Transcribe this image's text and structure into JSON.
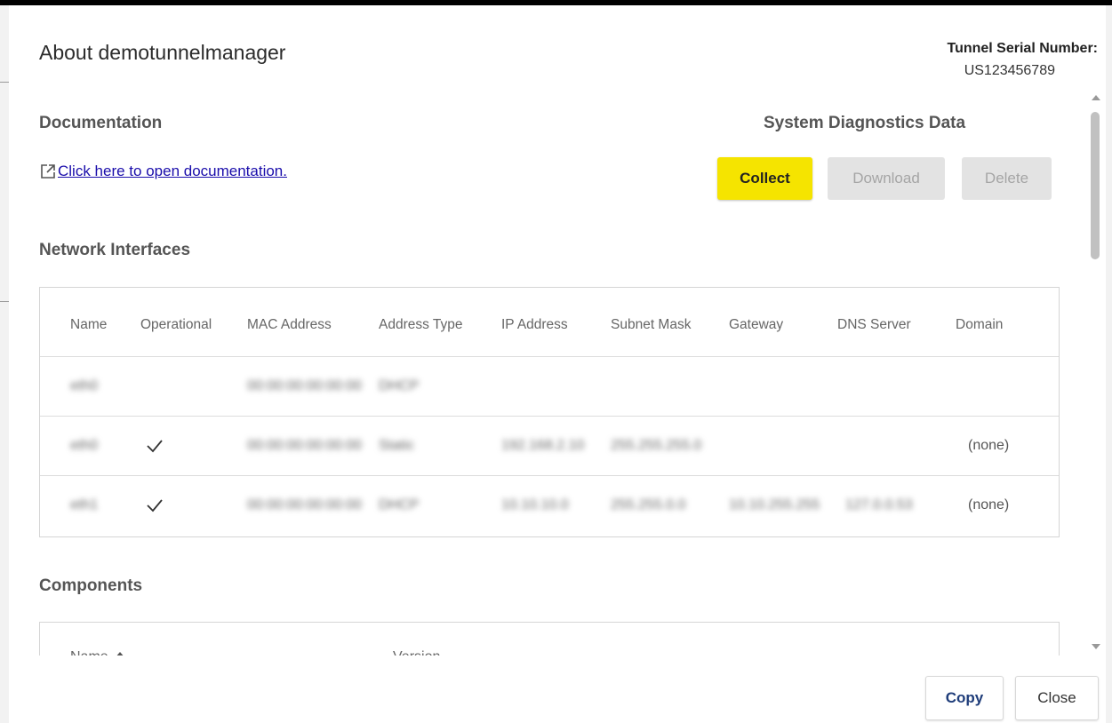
{
  "dialog": {
    "title": "About demotunnelmanager",
    "serial_label": "Tunnel Serial Number:",
    "serial_value": "US123456789"
  },
  "documentation": {
    "heading": "Documentation",
    "link_text": "Click here to open documentation.",
    "link_icon": "external-link-icon"
  },
  "diagnostics": {
    "heading": "System Diagnostics Data",
    "collect_label": "Collect",
    "download_label": "Download",
    "delete_label": "Delete",
    "collect_color": "#f5e400"
  },
  "network": {
    "heading": "Network Interfaces",
    "columns": [
      "Name",
      "Operational",
      "MAC Address",
      "Address Type",
      "IP Address",
      "Subnet Mask",
      "Gateway",
      "DNS Server",
      "Domain"
    ],
    "rows": [
      {
        "name": "eth0",
        "operational": false,
        "mac": "00:00:00:00:00:00",
        "address_type": "DHCP",
        "ip": "",
        "subnet": "",
        "gateway": "",
        "dns": "",
        "domain": ""
      },
      {
        "name": "eth0",
        "operational": true,
        "mac": "00:00:00:00:00:00",
        "address_type": "Static",
        "ip": "192.168.2.10",
        "subnet": "255.255.255.0",
        "gateway": "",
        "dns": "",
        "domain": "(none)"
      },
      {
        "name": "eth1",
        "operational": true,
        "mac": "00:00:00:00:00:00",
        "address_type": "DHCP",
        "ip": "10.10.10.0",
        "subnet": "255.255.0.0",
        "gateway": "10.10.255.255",
        "dns": "127.0.0.53",
        "domain": "(none)"
      }
    ]
  },
  "components": {
    "heading": "Components",
    "columns": [
      "Name",
      "Version"
    ],
    "sort_icon": "sort-up-arrow-icon"
  },
  "footer": {
    "copy_label": "Copy",
    "close_label": "Close"
  }
}
